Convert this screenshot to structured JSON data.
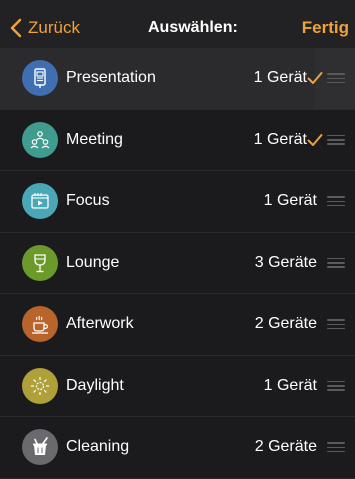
{
  "nav": {
    "back_label": "Zurück",
    "title": "Auswählen:",
    "done_label": "Fertig"
  },
  "colors": {
    "accent": "#f0a13a",
    "background": "#1b1b1d"
  },
  "scenes": [
    {
      "name": "Presentation",
      "count": "1 Gerät",
      "checked": true,
      "icon": "presentation-icon",
      "color": "#3f6fb0"
    },
    {
      "name": "Meeting",
      "count": "1 Gerät",
      "checked": true,
      "icon": "meeting-icon",
      "color": "#3f9c8e"
    },
    {
      "name": "Focus",
      "count": "1 Gerät",
      "checked": false,
      "icon": "focus-icon",
      "color": "#4aa8b6"
    },
    {
      "name": "Lounge",
      "count": "3 Geräte",
      "checked": false,
      "icon": "lounge-icon",
      "color": "#6c9a2a"
    },
    {
      "name": "Afterwork",
      "count": "2 Geräte",
      "checked": false,
      "icon": "afterwork-icon",
      "color": "#b8642a"
    },
    {
      "name": "Daylight",
      "count": "1 Gerät",
      "checked": false,
      "icon": "daylight-icon",
      "color": "#b0a03a"
    },
    {
      "name": "Cleaning",
      "count": "2 Geräte",
      "checked": false,
      "icon": "cleaning-icon",
      "color": "#6a6a6e"
    }
  ]
}
